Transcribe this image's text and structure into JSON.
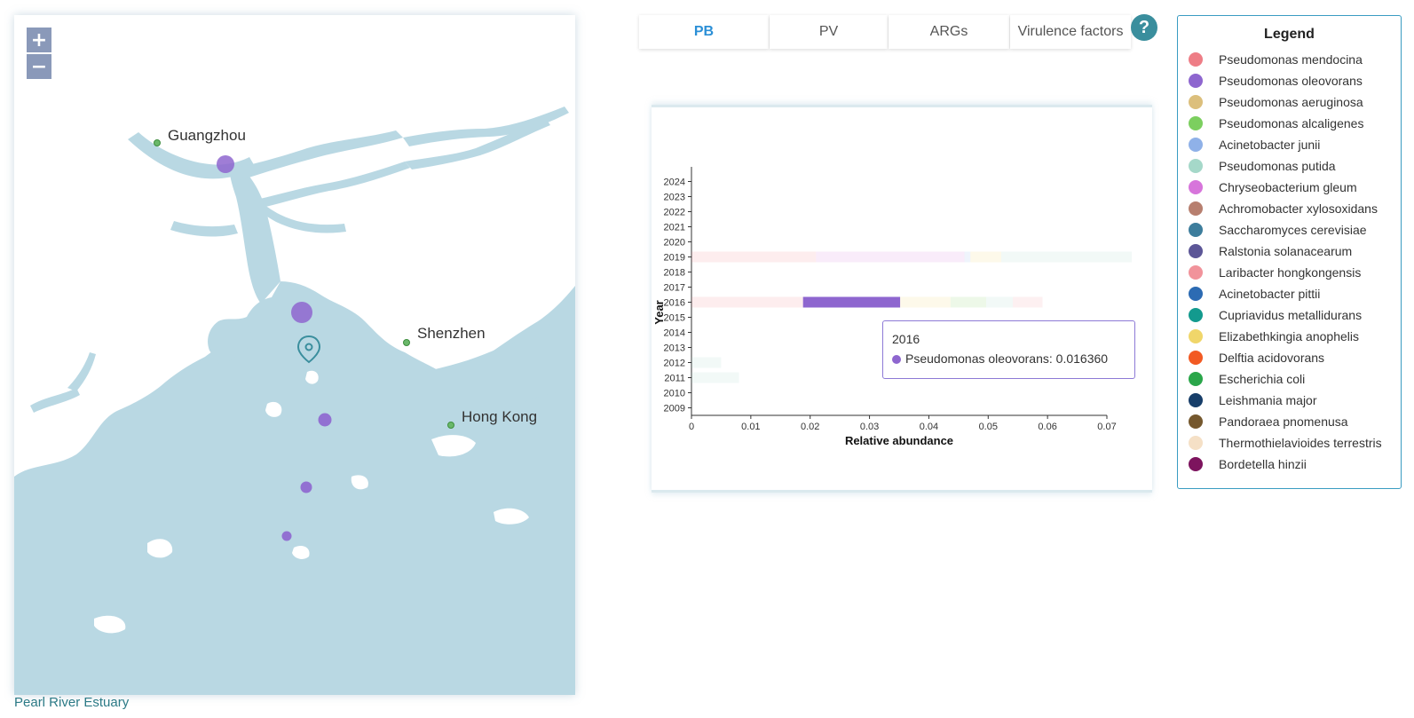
{
  "map": {
    "zoom_in_label": "+",
    "zoom_out_label": "−",
    "cities": [
      "Guangzhou",
      "Shenzhen",
      "Hong Kong"
    ],
    "water_color": "#b9d8e3",
    "sample_color": "#8e66cf",
    "region_link": "Pearl River Estuary"
  },
  "tabs": [
    {
      "label": "PB",
      "active": true
    },
    {
      "label": "PV",
      "active": false
    },
    {
      "label": "ARGs",
      "active": false
    },
    {
      "label": "Virulence factors",
      "active": false
    }
  ],
  "help_label": "?",
  "chart_data": {
    "type": "bar",
    "orientation": "horizontal",
    "stacked": true,
    "ylabel": "Year",
    "xlabel": "Relative abundance",
    "categories": [
      "2024",
      "2023",
      "2022",
      "2021",
      "2020",
      "2019",
      "2018",
      "2017",
      "2016",
      "2015",
      "2014",
      "2013",
      "2012",
      "2011",
      "2010",
      "2009"
    ],
    "xlim": [
      0,
      0.07
    ],
    "xticks": [
      "0",
      "0.01",
      "0.02",
      "0.03",
      "0.04",
      "0.05",
      "0.06",
      "0.07"
    ],
    "series": [
      {
        "name": "Pseudomonas mendocina",
        "color": "#ee7d86",
        "values": {
          "2019": 0.021,
          "2016": 0.0188
        }
      },
      {
        "name": "Pseudomonas oleovorans",
        "color": "#8e66cf",
        "values": {
          "2019": 0.0,
          "2016": 0.01636
        }
      },
      {
        "name": "Chryseobacterium gleum",
        "color": "#d775db",
        "values": {
          "2019": 0.025
        }
      },
      {
        "name": "Acinetobacter junii",
        "color": "#8fb1e8",
        "values": {
          "2019": 0.001
        }
      },
      {
        "name": "Elizabethkingia anophelis",
        "color": "#f0d66a",
        "values": {
          "2019": 0.0052,
          "2016": 0.0085
        }
      },
      {
        "name": "Pseudomonas alcaligenes",
        "color": "#7ccf5f",
        "values": {
          "2016": 0.006
        }
      },
      {
        "name": "Pseudomonas putida",
        "color": "#a5d8c9",
        "values": {
          "2019": 0.022,
          "2016": 0.0045,
          "2012": 0.005,
          "2011": 0.008
        }
      },
      {
        "name": "Laribacter hongkongensis",
        "color": "#f1939b",
        "values": {
          "2016": 0.005
        }
      }
    ],
    "tooltip": {
      "year": "2016",
      "series": "Pseudomonas oleovorans",
      "value": "0.016360"
    }
  },
  "tooltip": {
    "year": "2016",
    "text": "Pseudomonas oleovorans: 0.016360",
    "color": "#8e66cf"
  },
  "legend": {
    "title": "Legend",
    "items": [
      {
        "label": "Pseudomonas mendocina",
        "color": "#ee7d86"
      },
      {
        "label": "Pseudomonas oleovorans",
        "color": "#8e66cf"
      },
      {
        "label": "Pseudomonas aeruginosa",
        "color": "#dcbf7c"
      },
      {
        "label": "Pseudomonas alcaligenes",
        "color": "#7ccf5f"
      },
      {
        "label": "Acinetobacter junii",
        "color": "#8fb1e8"
      },
      {
        "label": "Pseudomonas putida",
        "color": "#a5d8c9"
      },
      {
        "label": "Chryseobacterium gleum",
        "color": "#d775db"
      },
      {
        "label": "Achromobacter xylosoxidans",
        "color": "#b77f6f"
      },
      {
        "label": "Saccharomyces cerevisiae",
        "color": "#3d7d9c"
      },
      {
        "label": "Ralstonia solanacearum",
        "color": "#5c5697"
      },
      {
        "label": "Laribacter hongkongensis",
        "color": "#f1939b"
      },
      {
        "label": "Acinetobacter pittii",
        "color": "#2c6bb3"
      },
      {
        "label": "Cupriavidus metallidurans",
        "color": "#139a8e"
      },
      {
        "label": "Elizabethkingia anophelis",
        "color": "#f0d66a"
      },
      {
        "label": "Delftia acidovorans",
        "color": "#f25a23"
      },
      {
        "label": "Escherichia coli",
        "color": "#2aa64a"
      },
      {
        "label": "Leishmania major",
        "color": "#173e69"
      },
      {
        "label": "Pandoraea pnomenusa",
        "color": "#75582e"
      },
      {
        "label": "Thermothielavioides terrestris",
        "color": "#f5e0c6"
      },
      {
        "label": "Bordetella hinzii",
        "color": "#7d145e"
      }
    ]
  }
}
